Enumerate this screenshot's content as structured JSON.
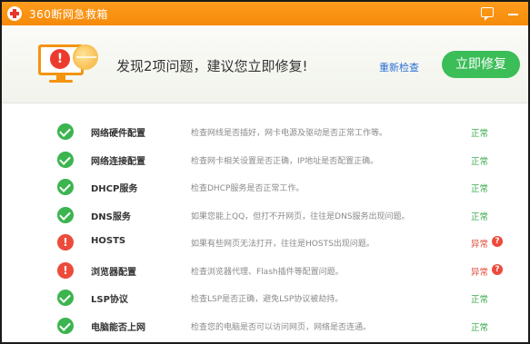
{
  "window": {
    "title": "360断网急救箱",
    "accent_color": "#f58a08"
  },
  "header": {
    "headline": "发现2项问题，建议您立即修复!",
    "recheck_label": "重新检查",
    "fix_label": "立即修复",
    "alert_glyph": "!"
  },
  "items": [
    {
      "name": "网络硬件配置",
      "desc": "检查网线是否插好，网卡电源及驱动是否正常工作等。",
      "status": "正常",
      "state": "ok"
    },
    {
      "name": "网络连接配置",
      "desc": "检查网卡相关设置是否正确，IP地址是否配置正确。",
      "status": "正常",
      "state": "ok"
    },
    {
      "name": "DHCP服务",
      "desc": "检查DHCP服务是否正常工作。",
      "status": "正常",
      "state": "ok"
    },
    {
      "name": "DNS服务",
      "desc": "如果您能上QQ，但打不开网页，往往是DNS服务出现问题。",
      "status": "正常",
      "state": "ok"
    },
    {
      "name": "HOSTS",
      "desc": "如果有些网页无法打开，往往是HOSTS出现问题。",
      "status": "异常",
      "state": "warn"
    },
    {
      "name": "浏览器配置",
      "desc": "检查浏览器代理、Flash插件等配置问题。",
      "status": "异常",
      "state": "warn"
    },
    {
      "name": "LSP协议",
      "desc": "检查LSP是否正确，避免LSP协议被劫持。",
      "status": "正常",
      "state": "ok"
    },
    {
      "name": "电脑能否上网",
      "desc": "检查您的电脑是否可以访问网页，网络是否连通。",
      "status": "正常",
      "state": "ok"
    }
  ],
  "glyphs": {
    "warn": "!",
    "help": "?"
  }
}
